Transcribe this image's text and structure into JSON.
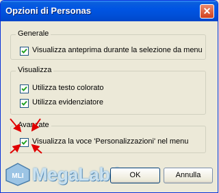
{
  "window": {
    "title": "Opzioni di Personas",
    "close_glyph": "✕"
  },
  "groups": {
    "general": {
      "legend": "Generale",
      "items": [
        {
          "label": "Visualizza anteprima durante la selezione da menu",
          "checked": true
        }
      ]
    },
    "display": {
      "legend": "Visualizza",
      "items": [
        {
          "label": "Utilizza testo colorato",
          "checked": true
        },
        {
          "label": "Utilizza evidenziatore",
          "checked": true
        }
      ]
    },
    "advanced": {
      "legend": "Avanzate",
      "items": [
        {
          "label": "Visualizza la voce 'Personalizzazioni' nel menu",
          "checked": true
        }
      ]
    }
  },
  "buttons": {
    "ok": "OK",
    "cancel": "Annulla"
  },
  "watermark": {
    "text": "MegaLab.it",
    "logo": "MLI"
  },
  "colors": {
    "accent": "#0054e3",
    "check": "#21a121",
    "arrow": "#e00000"
  }
}
